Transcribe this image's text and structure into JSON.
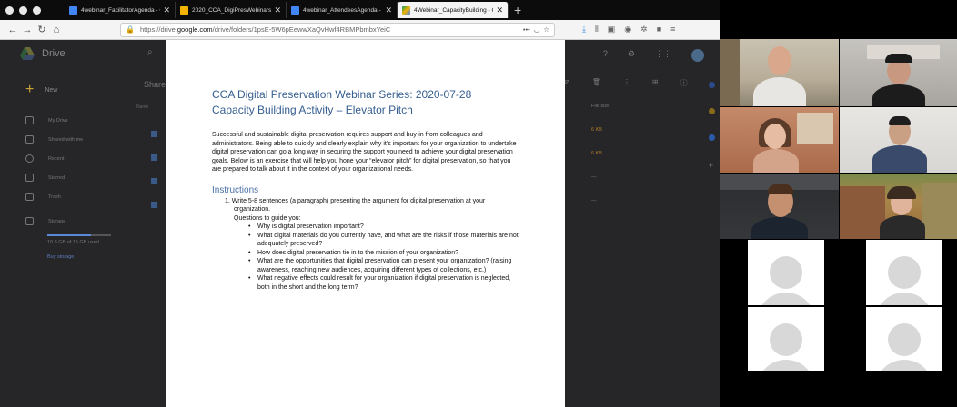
{
  "browser": {
    "tabs": [
      {
        "title": "4webinar_FacilitatorAgenda - G",
        "icon_color": "#4285f4",
        "active": false
      },
      {
        "title": "2020_CCA_DigiPresWebinars_S",
        "icon_color": "#f4b400",
        "active": false
      },
      {
        "title": "4webinar_AttendeesAgenda - G",
        "icon_color": "#4285f4",
        "active": false
      },
      {
        "title": "4Webinar_CapacityBuilding - G",
        "icon_color": "#4285f4",
        "active": true
      }
    ],
    "url_prefix": "https://drive.",
    "url_domain": "google.com",
    "url_rest": "/drive/folders/1psE-5W6pEewwXaQvHwf4RBMPbmbxYeiC",
    "url_extras": "•••"
  },
  "drive": {
    "title": "Drive",
    "new_label": "New",
    "shared_label": "Share",
    "names_header": "Name",
    "nav": [
      {
        "label": "My Drive"
      },
      {
        "label": "Shared with me"
      },
      {
        "label": "Recent"
      },
      {
        "label": "Starred"
      },
      {
        "label": "Trash"
      }
    ],
    "storage_label": "Storage",
    "storage_used": "10.8 GB of 15 GB used",
    "buy_storage": "Buy storage",
    "file_size_header": "File size",
    "sizes": [
      "6 KB",
      "6 KB",
      "—",
      "—"
    ]
  },
  "document": {
    "title_line1": "CCA Digital Preservation Webinar Series: 2020-07-28",
    "title_line2": "Capacity Building Activity – Elevator Pitch",
    "intro": "Successful and sustainable digital preservation requires support and buy-in from colleagues and administrators. Being able to quickly and clearly explain why it’s important for your organization to undertake digital preservation can go a long way in securing the support you need to achieve your digital preservation goals. Below is an exercise that will help you hone your “elevator pitch” for digital preservation, so that you are prepared to talk about it in the context of your organizational needs.",
    "instructions_heading": "Instructions",
    "item1": "1.  Write 5-8 sentences (a paragraph) presenting the argument for digital preservation at your organization.",
    "guide_label": "Questions to guide you:",
    "questions": [
      "Why is digital preservation important?",
      "What digital materials do you currently have, and what are the risks if those materials are not adequately preserved?",
      "How does digital preservation tie in to the mission of your organization?",
      "What are the opportunities that digital preservation can present your organization? (raising awareness, reaching new audiences, acquiring different types of collections, etc.)",
      "What negative effects could result for your organization if digital preservation is neglected, both in the short and the long term?"
    ]
  },
  "participants": {
    "video_count": 6,
    "avatar_count": 4
  }
}
